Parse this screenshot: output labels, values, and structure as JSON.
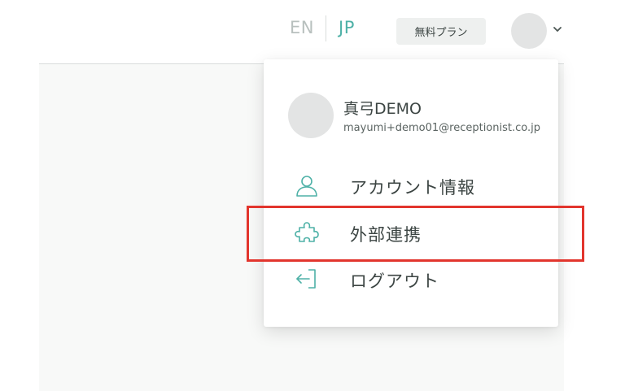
{
  "header": {
    "lang_en": "EN",
    "lang_jp": "JP",
    "plan_label": "無料プラン"
  },
  "user_menu": {
    "name": "真弓DEMO",
    "email": "mayumi+demo01@receptionist.co.jp",
    "items": [
      {
        "label": "アカウント情報",
        "icon": "user-icon"
      },
      {
        "label": "外部連携",
        "icon": "puzzle-icon"
      },
      {
        "label": "ログアウト",
        "icon": "logout-icon"
      }
    ]
  },
  "colors": {
    "accent": "#4eb1a7",
    "highlight": "#e2352d",
    "text": "#3c4543",
    "muted": "#b8c0be"
  }
}
